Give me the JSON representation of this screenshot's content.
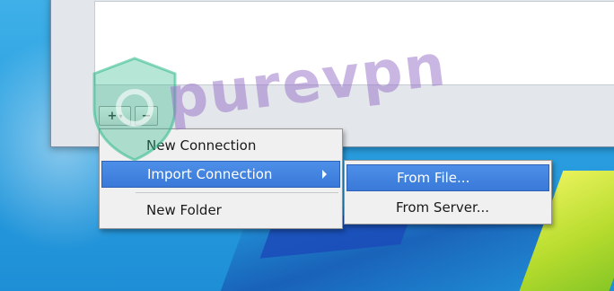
{
  "toolbar": {
    "add_label": "+",
    "add_chevron": "▾",
    "remove_label": "−"
  },
  "context_menu": {
    "items": [
      {
        "label": "New Connection",
        "highlighted": false
      },
      {
        "label": "Import Connection",
        "highlighted": true,
        "has_submenu": true
      },
      {
        "label": "New Folder",
        "highlighted": false
      }
    ]
  },
  "submenu": {
    "items": [
      {
        "label": "From File...",
        "highlighted": true
      },
      {
        "label": "From Server...",
        "highlighted": false
      }
    ]
  },
  "watermark": {
    "text": "purevpn",
    "color": "#9a6fd0",
    "shield_color": "#2fb98a"
  },
  "colors": {
    "highlight": "#3a79d8",
    "menu_bg": "#f0f0f0",
    "desktop": "#2a9fe0"
  }
}
